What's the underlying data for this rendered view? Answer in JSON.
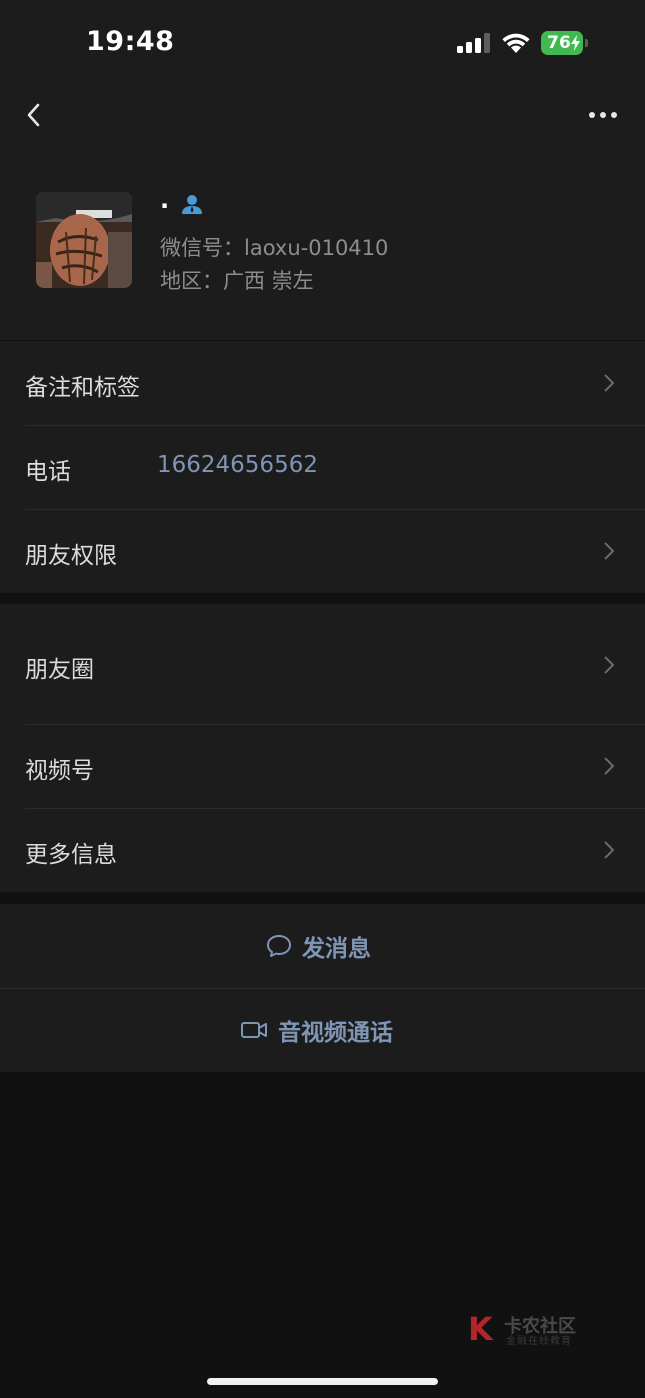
{
  "status_bar": {
    "time": "19:48",
    "battery_level": "76"
  },
  "profile": {
    "nickname": "·",
    "wechat_id": "微信号：laoxu-010410",
    "region": "地区：广西 崇左"
  },
  "rows": {
    "notes_tags": "备注和标签",
    "phone_label": "电话",
    "phone_value": "16624656562",
    "friend_permissions": "朋友权限",
    "moments": "朋友圈",
    "channels": "视频号",
    "more_info": "更多信息"
  },
  "actions": {
    "send_message": "发消息",
    "video_call": "音视频通话"
  },
  "watermark": {
    "title": "卡农社区",
    "subtitle": "金融在线教育"
  },
  "colors": {
    "background": "#111111",
    "panel": "#1c1c1c",
    "link": "#7f95b5",
    "battery": "#3fb950"
  }
}
